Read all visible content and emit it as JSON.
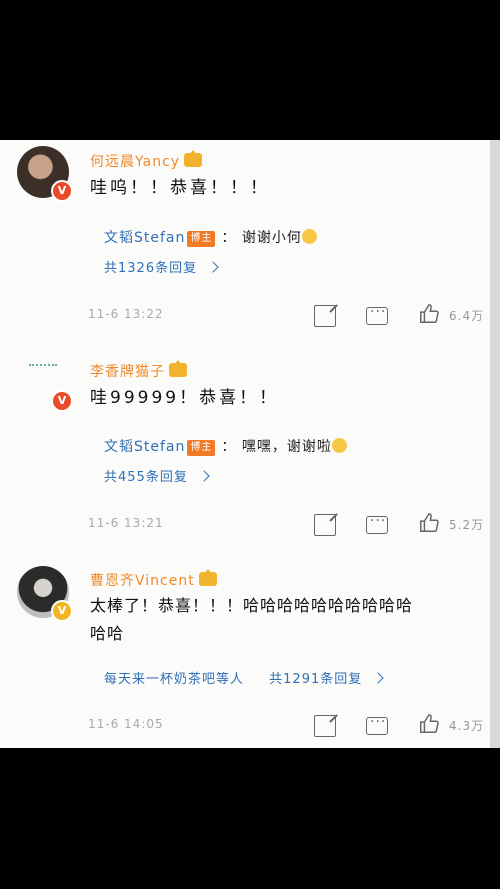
{
  "comments": [
    {
      "username": "何远晨Yancy",
      "text": "哇呜！！恭喜！！！",
      "reply": {
        "author": "文韬Stefan",
        "badge": "博主",
        "sep": "：",
        "text": "谢谢小何"
      },
      "more": "共1326条回复",
      "time": "11-6 13:22",
      "likes": "6.4万"
    },
    {
      "username": "李香牌猫子",
      "text": "哇99999！恭喜！！",
      "reply": {
        "author": "文韬Stefan",
        "badge": "博主",
        "sep": "：",
        "text": "嘿嘿，谢谢啦"
      },
      "more": "共455条回复",
      "time": "11-6 13:21",
      "likes": "5.2万"
    },
    {
      "username": "曹恩齐Vincent",
      "text_line1": "太棒了！恭喜！！！哈哈哈哈哈哈哈哈哈哈",
      "text_line2": "哈哈",
      "preview_user": "每天来一杯奶茶吧等人",
      "more": "共1291条回复",
      "time": "11-6 14:05",
      "likes": "4.3万"
    }
  ],
  "colors": {
    "username": "#ef8b2c",
    "link": "#2f6fb6",
    "host_badge": "#f07a26"
  }
}
